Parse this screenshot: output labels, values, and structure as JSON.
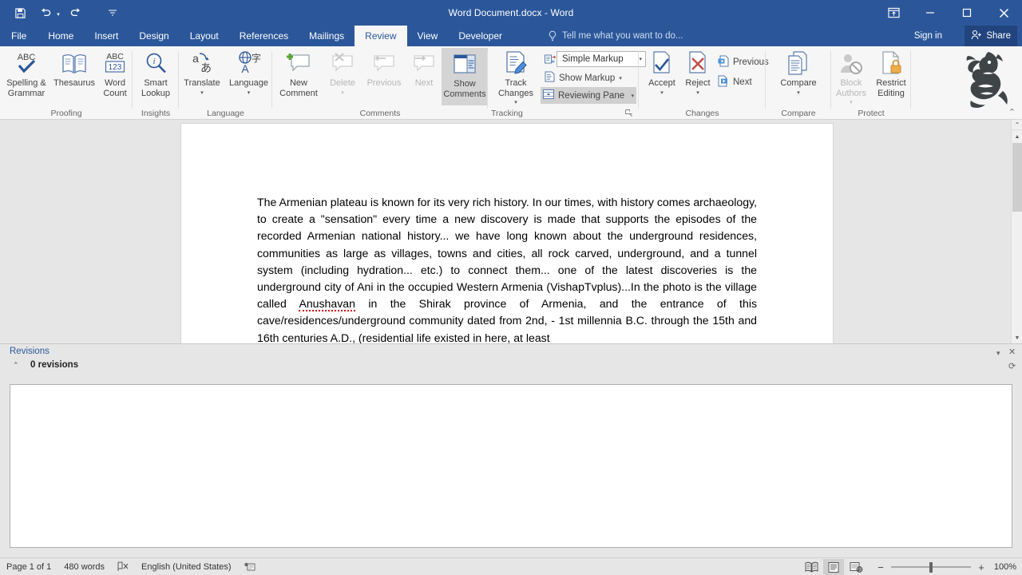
{
  "titlebar": {
    "title": "Word Document.docx - Word",
    "quick_access": [
      {
        "name": "save",
        "label": "Save"
      },
      {
        "name": "undo",
        "label": "Undo"
      },
      {
        "name": "redo",
        "label": "Redo"
      },
      {
        "name": "customize",
        "label": "Customize Quick Access Toolbar"
      }
    ],
    "ribbon_display_label": "Ribbon Display Options",
    "minimize_label": "—",
    "restore_label": "❐",
    "close_label": "✕"
  },
  "tabs": [
    {
      "id": "file",
      "label": "File",
      "active": false
    },
    {
      "id": "home",
      "label": "Home",
      "active": false
    },
    {
      "id": "insert",
      "label": "Insert",
      "active": false
    },
    {
      "id": "design",
      "label": "Design",
      "active": false
    },
    {
      "id": "layout",
      "label": "Layout",
      "active": false
    },
    {
      "id": "references",
      "label": "References",
      "active": false
    },
    {
      "id": "mailings",
      "label": "Mailings",
      "active": false
    },
    {
      "id": "review",
      "label": "Review",
      "active": true
    },
    {
      "id": "view",
      "label": "View",
      "active": false
    },
    {
      "id": "developer",
      "label": "Developer",
      "active": false
    }
  ],
  "tellme": {
    "placeholder": "Tell me what you want to do..."
  },
  "account": {
    "signin": "Sign in",
    "share": "Share"
  },
  "ribbon": {
    "groups": [
      {
        "id": "proofing",
        "label": "Proofing",
        "buttons": [
          {
            "id": "spelling-grammar",
            "label": "Spelling &\nGrammar",
            "state": "normal"
          },
          {
            "id": "thesaurus",
            "label": "Thesaurus",
            "state": "normal"
          },
          {
            "id": "word-count",
            "label": "Word\nCount",
            "state": "normal"
          }
        ]
      },
      {
        "id": "insights",
        "label": "Insights",
        "buttons": [
          {
            "id": "smart-lookup",
            "label": "Smart\nLookup",
            "state": "normal"
          }
        ]
      },
      {
        "id": "language",
        "label": "Language",
        "buttons": [
          {
            "id": "translate",
            "label": "Translate",
            "state": "normal",
            "split": true
          },
          {
            "id": "language",
            "label": "Language",
            "state": "normal",
            "split": true
          }
        ]
      },
      {
        "id": "comments",
        "label": "Comments",
        "buttons": [
          {
            "id": "new-comment",
            "label": "New\nComment",
            "state": "normal"
          },
          {
            "id": "delete-comment",
            "label": "Delete",
            "state": "disabled",
            "split": true
          },
          {
            "id": "previous-comment",
            "label": "Previous",
            "state": "disabled"
          },
          {
            "id": "next-comment",
            "label": "Next",
            "state": "disabled"
          },
          {
            "id": "show-comments",
            "label": "Show\nComments",
            "state": "pressed"
          }
        ]
      },
      {
        "id": "tracking",
        "label": "Tracking",
        "buttons": [
          {
            "id": "track-changes",
            "label": "Track\nChanges",
            "state": "normal",
            "split": true
          }
        ],
        "small_controls": [
          {
            "id": "markup-display",
            "label": "Simple Markup",
            "type": "combo"
          },
          {
            "id": "show-markup",
            "label": "Show Markup",
            "type": "menu"
          },
          {
            "id": "reviewing-pane",
            "label": "Reviewing Pane",
            "type": "menu",
            "state": "pressed"
          }
        ],
        "dialog_launcher": true
      },
      {
        "id": "changes",
        "label": "Changes",
        "buttons": [
          {
            "id": "accept",
            "label": "Accept",
            "state": "normal",
            "split": true
          },
          {
            "id": "reject",
            "label": "Reject",
            "state": "normal",
            "split": true
          }
        ],
        "small_controls": [
          {
            "id": "previous-change",
            "label": "Previous"
          },
          {
            "id": "next-change",
            "label": "Next"
          }
        ]
      },
      {
        "id": "compare",
        "label": "Compare",
        "buttons": [
          {
            "id": "compare",
            "label": "Compare",
            "state": "normal",
            "split": true
          }
        ]
      },
      {
        "id": "protect",
        "label": "Protect",
        "buttons": [
          {
            "id": "block-authors",
            "label": "Block\nAuthors",
            "state": "disabled",
            "split": true
          },
          {
            "id": "restrict-editing",
            "label": "Restrict\nEditing",
            "state": "normal"
          }
        ]
      }
    ],
    "collapse_label": "⌃"
  },
  "document": {
    "body": "The Armenian plateau is known for its very rich history. In our times, with history comes archaeology, to create a \"sensation\" every time a new discovery is made that supports the episodes of the recorded Armenian national history... we have long known about the underground residences, communities as large as villages, towns and cities, all rock carved, underground, and a tunnel system (including hydration... etc.) to connect them... one of the latest discoveries is the underground city of Ani in the occupied Western Armenia (VishapTvplus)...In the photo is the village called ",
    "misspelled_word": "Anushavan",
    "body_after": " in the Shirak province of Armenia, and the entrance of this cave/residences/underground community dated from 2nd, - 1st millennia B.C. through the 15th and 16th centuries A.D., (residential life existed in here, at least"
  },
  "revisions_pane": {
    "title": "Revisions",
    "count_label": "0 revisions",
    "collapse_icon": "⌃",
    "dropdown_icon": "▾",
    "close_icon": "✕",
    "refresh_icon": "⟳"
  },
  "statusbar": {
    "page": "Page 1 of 1",
    "words": "480 words",
    "proofing_icon": "proofing-errors-icon",
    "language": "English (United States)",
    "macro_icon": "macro-record-icon",
    "views": [
      {
        "id": "read-mode",
        "label": "Read Mode",
        "active": false
      },
      {
        "id": "print-layout",
        "label": "Print Layout",
        "active": true
      },
      {
        "id": "web-layout",
        "label": "Web Layout",
        "active": false
      }
    ],
    "zoom_out": "−",
    "zoom_in": "+",
    "zoom_level": "100%"
  },
  "colors": {
    "word_blue": "#2b579a",
    "ribbon_bg": "#f6f6f6",
    "canvas_bg": "#e6e6e6",
    "share_bg": "#21447e",
    "spell_error": "#d40000"
  }
}
